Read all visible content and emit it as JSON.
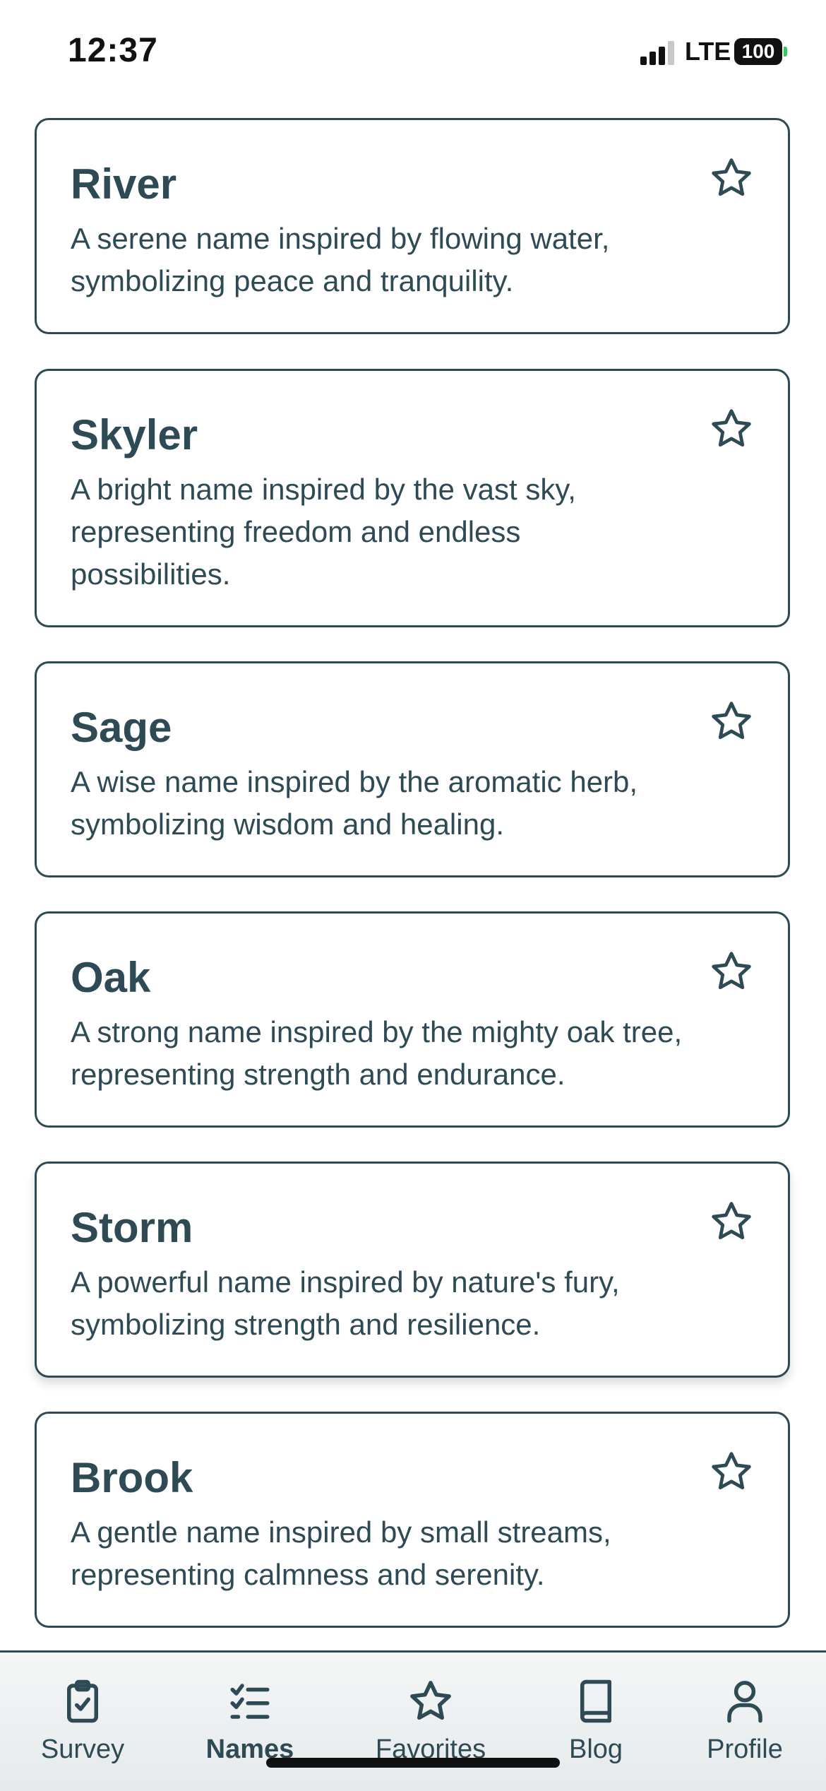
{
  "status_bar": {
    "time": "12:37",
    "network": "LTE",
    "battery": "100"
  },
  "names": [
    {
      "name": "River",
      "description": "A serene name inspired by flowing water, symbolizing peace and tranquility."
    },
    {
      "name": "Skyler",
      "description": "A bright name inspired by the vast sky, representing freedom and endless possibilities."
    },
    {
      "name": "Sage",
      "description": "A wise name inspired by the aromatic herb, symbolizing wisdom and healing."
    },
    {
      "name": "Oak",
      "description": "A strong name inspired by the mighty oak tree, representing strength and endurance."
    },
    {
      "name": "Storm",
      "description": "A powerful name inspired by nature's fury, symbolizing strength and resilience."
    },
    {
      "name": "Brook",
      "description": "A gentle name inspired by small streams, representing calmness and serenity."
    }
  ],
  "tabs": [
    {
      "label": "Survey",
      "icon": "clipboard-check-icon"
    },
    {
      "label": "Names",
      "icon": "checklist-icon",
      "active": true
    },
    {
      "label": "Favorites",
      "icon": "star-icon"
    },
    {
      "label": "Blog",
      "icon": "book-icon"
    },
    {
      "label": "Profile",
      "icon": "user-icon"
    }
  ],
  "colors": {
    "primary": "#2e4a55",
    "background": "#ffffff"
  }
}
